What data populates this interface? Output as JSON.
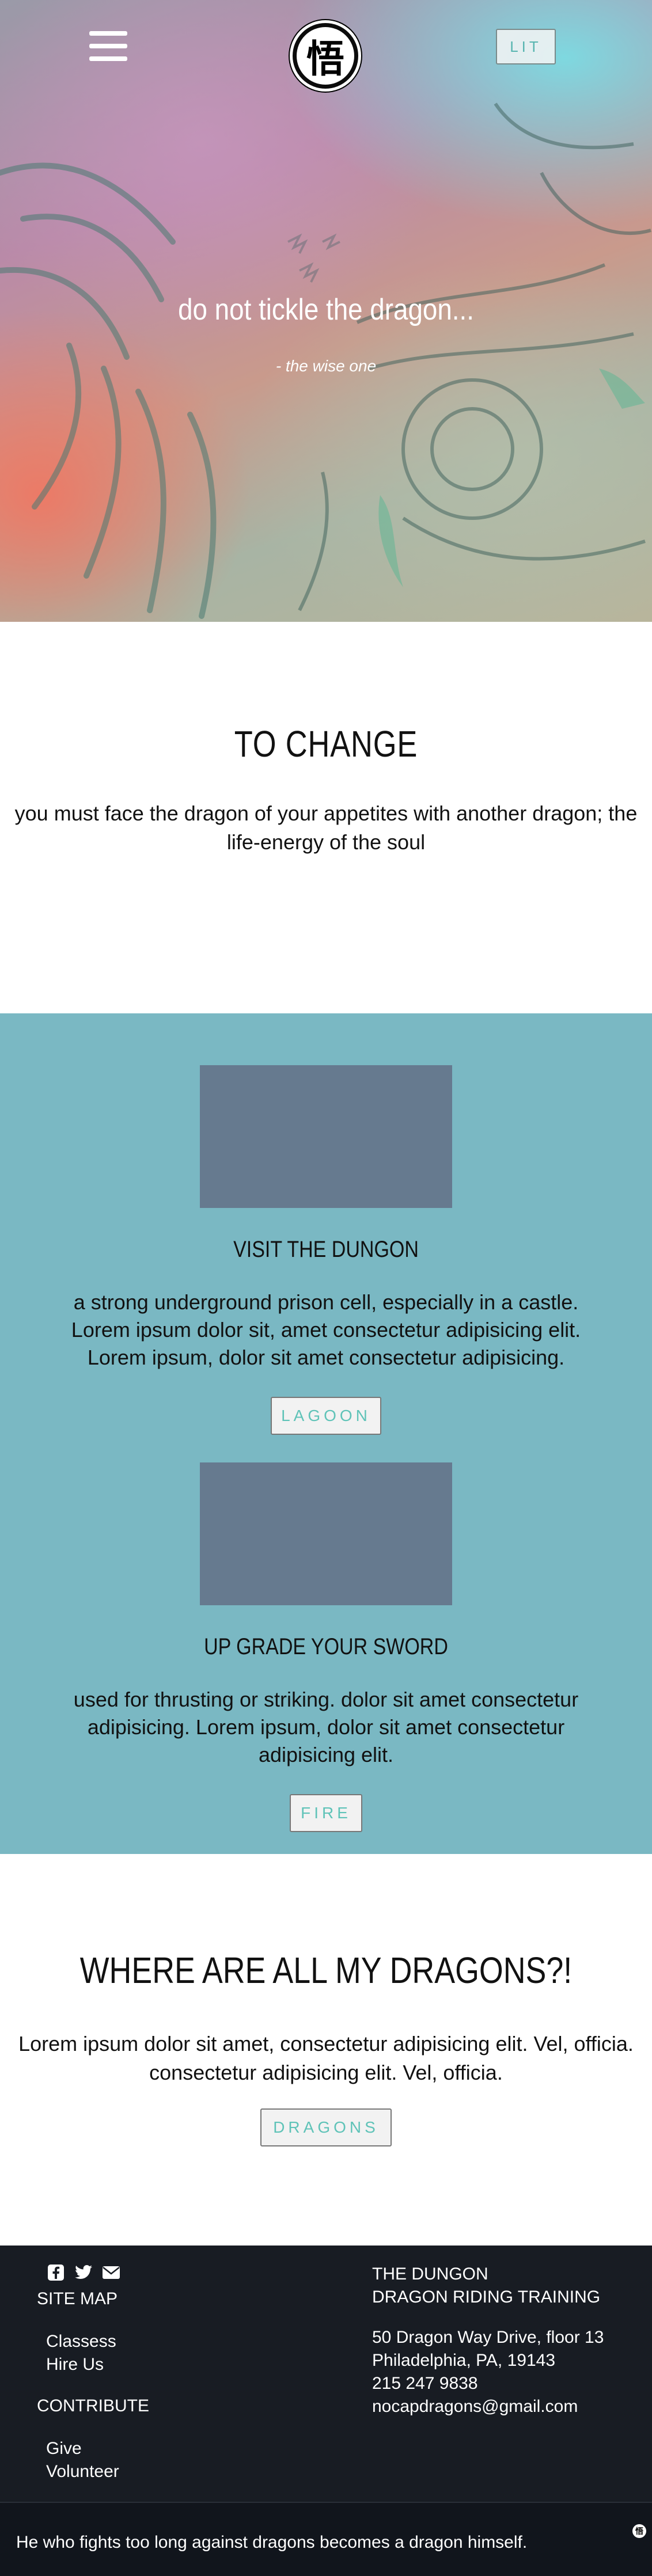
{
  "header": {
    "logo_glyph": "悟",
    "lit_button_label": "LIT"
  },
  "hero": {
    "title": "do not tickle the dragon...",
    "subtitle": "- the wise one"
  },
  "intro": {
    "heading": "TO CHANGE",
    "text": "you must face the dragon of your appetites with another dragon; the life-energy of the soul"
  },
  "cards": [
    {
      "title": "VISIT THE DUNGON",
      "text": "a strong underground prison cell, especially in a castle. Lorem ipsum dolor sit, amet consectetur adipisicing elit. Lorem ipsum, dolor sit amet consectetur adipisicing.",
      "button": "LAGOON"
    },
    {
      "title": "UP GRADE YOUR SWORD",
      "text": "used for thrusting or striking. dolor sit amet consectetur adipisicing. Lorem ipsum, dolor sit amet consectetur adipisicing elit.",
      "button": "FIRE"
    }
  ],
  "dragons": {
    "heading": "WHERE ARE ALL MY DRAGONS?!",
    "text": "Lorem ipsum dolor sit amet, consectetur adipisicing elit. Vel, officia. consectetur adipisicing elit. Vel, officia.",
    "button": "DRAGONS"
  },
  "footer": {
    "social_icons": [
      "facebook-icon",
      "twitter-icon",
      "envelope-icon"
    ],
    "site_map_heading": "SITE MAP",
    "site_map_links": [
      "Classess",
      "Hire Us"
    ],
    "contribute_heading": "CONTRIBUTE",
    "contribute_links": [
      "Give",
      "Volunteer"
    ],
    "org_name": "THE DUNGON",
    "org_tagline": "DRAGON RIDING TRAINING",
    "address_line1": "50 Dragon Way Drive, floor 13",
    "address_line2": "Philadelphia, PA, 19143",
    "phone": "215 247 9838",
    "email": "nocapdragons@gmail.com"
  },
  "bottom_bar": {
    "quote": "He who fights too long against dragons becomes a dragon himself.",
    "mini_logo_glyph": "悟"
  },
  "colors": {
    "teal_section": "#7ab8c3",
    "card_image": "#667a8f",
    "button_text": "#5fc3b8",
    "footer_bg": "#181c23"
  }
}
